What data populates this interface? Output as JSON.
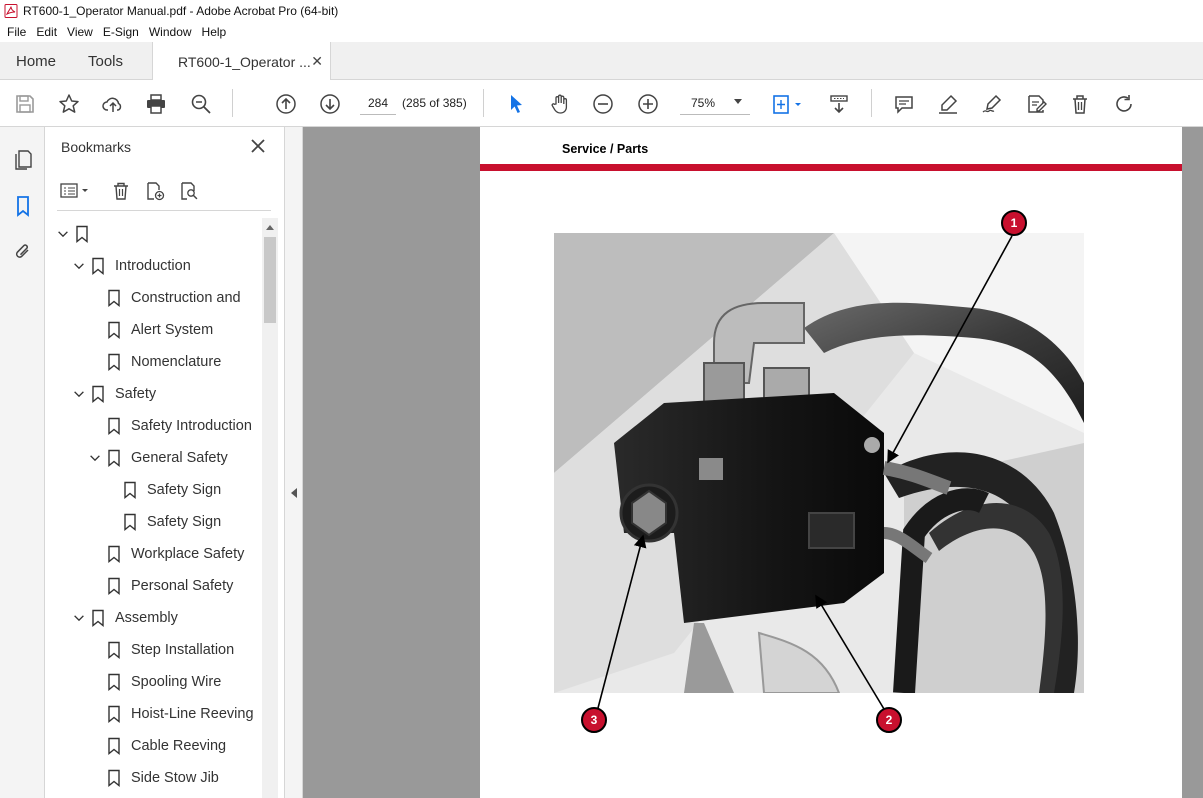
{
  "window": {
    "title": "RT600-1_Operator Manual.pdf - Adobe Acrobat Pro (64-bit)"
  },
  "menu": [
    "File",
    "Edit",
    "View",
    "E-Sign",
    "Window",
    "Help"
  ],
  "tabs": {
    "home": "Home",
    "tools": "Tools",
    "document": "RT600-1_Operator ...",
    "close_glyph": "✕"
  },
  "toolbar": {
    "page_number": "284",
    "page_count": "(285 of 385)",
    "zoom": "75%"
  },
  "bookmarks": {
    "header": "Bookmarks",
    "items": [
      {
        "label": "",
        "level": 0,
        "expanded": true
      },
      {
        "label": "Introduction",
        "level": 1,
        "expanded": true
      },
      {
        "label": "Construction and",
        "level": 2
      },
      {
        "label": "Alert System",
        "level": 2
      },
      {
        "label": "Nomenclature",
        "level": 2
      },
      {
        "label": "Safety",
        "level": 1,
        "expanded": true
      },
      {
        "label": "Safety Introduction",
        "level": 2
      },
      {
        "label": "General Safety",
        "level": 2,
        "expanded": true
      },
      {
        "label": "Safety Sign",
        "level": 3
      },
      {
        "label": "Safety Sign",
        "level": 3
      },
      {
        "label": "Workplace Safety",
        "level": 2
      },
      {
        "label": "Personal Safety",
        "level": 2
      },
      {
        "label": "Assembly",
        "level": 1,
        "expanded": true
      },
      {
        "label": "Step Installation",
        "level": 2
      },
      {
        "label": "Spooling Wire",
        "level": 2
      },
      {
        "label": "Hoist-Line Reeving",
        "level": 2
      },
      {
        "label": "Cable Reeving",
        "level": 2
      },
      {
        "label": "Side Stow Jib",
        "level": 2
      }
    ]
  },
  "document": {
    "header": "Service / Parts",
    "callouts": [
      "1",
      "2",
      "3"
    ],
    "accent_color": "#c8102e"
  }
}
